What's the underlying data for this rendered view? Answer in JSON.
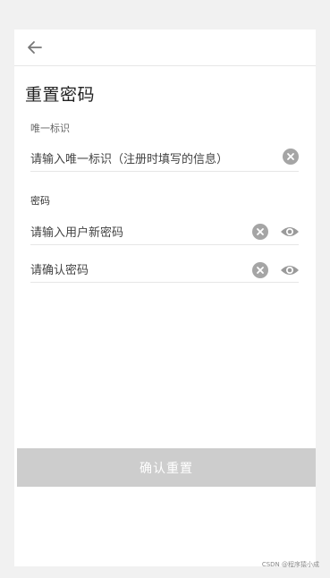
{
  "page": {
    "title": "重置密码"
  },
  "form": {
    "unique_id": {
      "label": "唯一标识",
      "placeholder": "请输入唯一标识（注册时填写的信息）"
    },
    "password_section_label": "密码",
    "new_password": {
      "placeholder": "请输入用户新密码"
    },
    "confirm_password": {
      "placeholder": "请确认密码"
    }
  },
  "actions": {
    "confirm_reset": "确认重置"
  },
  "watermark": "CSDN @程序猿小成"
}
